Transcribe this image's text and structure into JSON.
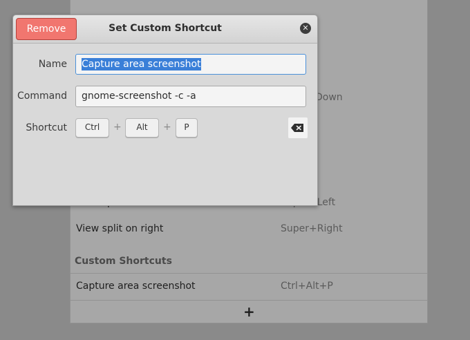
{
  "background": {
    "fragments": {
      "down": "Down",
      "view_left_name": "View split on left",
      "view_left_accel": "Super+Left"
    },
    "rows": [
      {
        "name": "View split on right",
        "accel": "Super+Right"
      }
    ],
    "section_title": "Custom Shortcuts",
    "custom_rows": [
      {
        "name": "Capture area screenshot",
        "accel": "Ctrl+Alt+P"
      }
    ],
    "add_symbol": "+"
  },
  "dialog": {
    "title": "Set Custom Shortcut",
    "remove_label": "Remove",
    "close_symbol": "✕",
    "name_label": "Name",
    "name_value": "Capture area screenshot",
    "command_label": "Command",
    "command_value": "gnome-screenshot -c -a",
    "shortcut_label": "Shortcut",
    "keys": [
      "Ctrl",
      "Alt",
      "P"
    ],
    "key_separator": "+",
    "clear_icon": "backspace-icon"
  },
  "colors": {
    "remove_button": "#f1766f",
    "selection": "#3a7fd8",
    "focus_border": "#4a90d9"
  }
}
